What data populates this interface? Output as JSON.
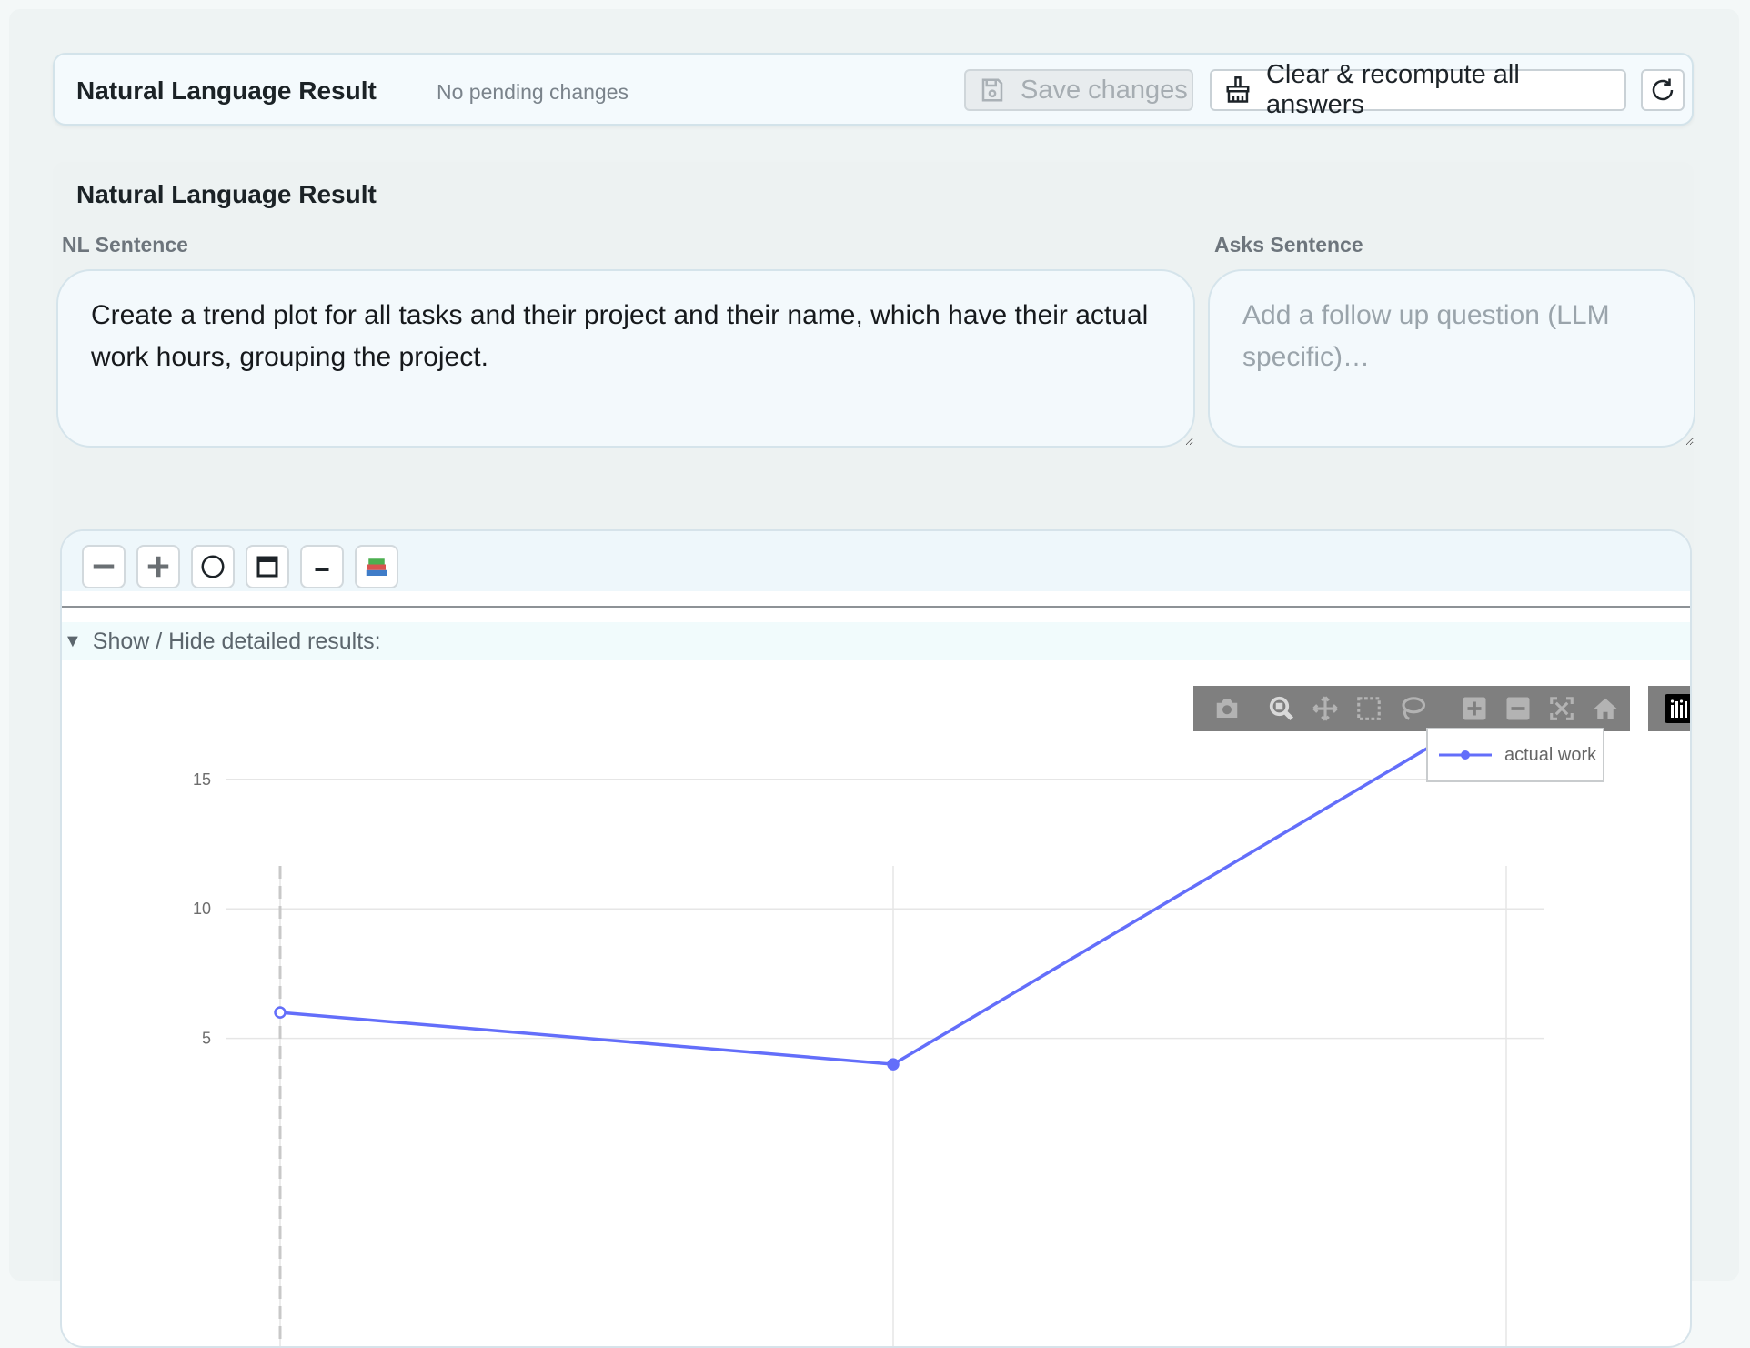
{
  "header": {
    "title": "Natural Language Result",
    "status": "No pending changes",
    "save_label": "Save changes",
    "clear_label": "Clear & recompute all answers"
  },
  "panel": {
    "title": "Natural Language Result",
    "nl_label": "NL Sentence",
    "nl_value": "Create a trend plot for all tasks and their project and their name, which have their actual work hours, grouping the project.",
    "asks_label": "Asks Sentence",
    "asks_placeholder": "Add a follow up question (LLM specific)…"
  },
  "toolbar": {
    "buttons": [
      "collapse-icon",
      "expand-icon",
      "circle-icon",
      "window-icon",
      "dash-icon",
      "books-icon"
    ]
  },
  "details": {
    "toggle_label": "Show / Hide detailed results:"
  },
  "colors": {
    "series": "#636efa",
    "accent": "#d3e3ea"
  },
  "chart_data": {
    "type": "line",
    "x": [
      0,
      1,
      2
    ],
    "series": [
      {
        "name": "actual work",
        "values": [
          6,
          4,
          18
        ]
      }
    ],
    "yticks": [
      "5",
      "10",
      "15"
    ],
    "legend_position": "top-right",
    "grid": true
  }
}
